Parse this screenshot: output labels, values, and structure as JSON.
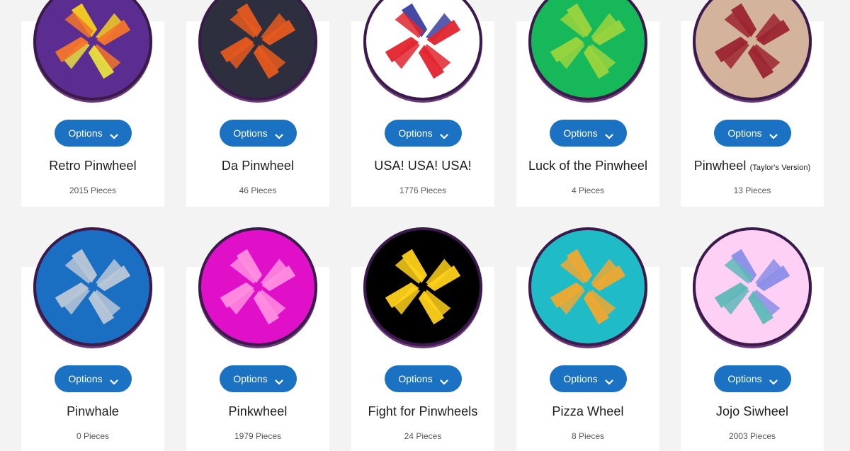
{
  "options_label": "Options",
  "pieces_suffix": "Pieces",
  "badges": [
    {
      "name": "Retro Pinwheel",
      "name_suffix": "",
      "count": "2015",
      "bg": "#5c2d91",
      "blades": [
        "#f5d020",
        "#f5762a",
        "#e8e040",
        "#f5762a"
      ]
    },
    {
      "name": "Da Pinwheel",
      "name_suffix": "",
      "count": "46",
      "bg": "#2e2f3e",
      "blades": [
        "#e65a1f",
        "#e65a1f",
        "#e65a1f",
        "#e65a1f"
      ]
    },
    {
      "name": "USA! USA! USA!",
      "name_suffix": "",
      "count": "1776",
      "bg": "#ffffff",
      "blades": [
        "#3a3f9e",
        "#e1242e",
        "#e1242e",
        "#e1242e"
      ]
    },
    {
      "name": "Luck of the Pinwheel",
      "name_suffix": "",
      "count": "4",
      "bg": "#17b85a",
      "blades": [
        "#9ad43e",
        "#9ad43e",
        "#9ad43e",
        "#9ad43e"
      ]
    },
    {
      "name": "Pinwheel",
      "name_suffix": "(Taylor's Version)",
      "count": "13",
      "bg": "#d4b39c",
      "blades": [
        "#9b2530",
        "#9b2530",
        "#9b2530",
        "#9b2530"
      ]
    },
    {
      "name": "Pinwhale",
      "name_suffix": "",
      "count": "0",
      "bg": "#1b6fc2",
      "blades": [
        "#b9c7d6",
        "#b9c7d6",
        "#b9c7d6",
        "#b9c7d6"
      ]
    },
    {
      "name": "Pinkwheel",
      "name_suffix": "",
      "count": "1979",
      "bg": "#e010c8",
      "blades": [
        "#ff8fe0",
        "#ff8fe0",
        "#ff8fe0",
        "#ff8fe0"
      ]
    },
    {
      "name": "Fight for Pinwheels",
      "name_suffix": "",
      "count": "24",
      "bg": "#000000",
      "blades": [
        "#ffd11a",
        "#ffd11a",
        "#ffd11a",
        "#ffd11a"
      ]
    },
    {
      "name": "Pizza Wheel",
      "name_suffix": "",
      "count": "8",
      "bg": "#1fbcc8",
      "blades": [
        "#f0a830",
        "#f0a830",
        "#f0a830",
        "#f0a830"
      ]
    },
    {
      "name": "Jojo Siwheel",
      "name_suffix": "",
      "count": "2003",
      "bg": "#ffd0f5",
      "blades": [
        "#8a8ee8",
        "#8a8ee8",
        "#5fb8b8",
        "#5fb8b8"
      ]
    }
  ]
}
